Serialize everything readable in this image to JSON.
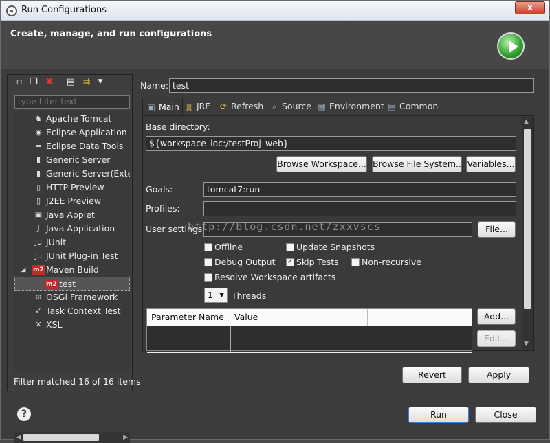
{
  "window": {
    "title": "Run Configurations",
    "close_label": "x"
  },
  "header": {
    "title": "Create, manage, and run configurations",
    "run_icon": "run-icon"
  },
  "left": {
    "toolbar_icons": [
      "new-configuration-icon",
      "duplicate-icon",
      "delete-icon",
      "collapse-all-icon",
      "filter-icon",
      "dropdown-icon"
    ],
    "filter_placeholder": "type filter text",
    "tree": [
      {
        "label": "Apache Tomcat",
        "icon": "tomcat-icon",
        "level": 0
      },
      {
        "label": "Eclipse Application",
        "icon": "eclipse-icon",
        "level": 0
      },
      {
        "label": "Eclipse Data Tools",
        "icon": "data-tools-icon",
        "level": 0
      },
      {
        "label": "Generic Server",
        "icon": "server-icon",
        "level": 0
      },
      {
        "label": "Generic Server(Extern",
        "icon": "server-icon",
        "level": 0
      },
      {
        "label": "HTTP Preview",
        "icon": "http-icon",
        "level": 0
      },
      {
        "label": "J2EE Preview",
        "icon": "j2ee-icon",
        "level": 0
      },
      {
        "label": "Java Applet",
        "icon": "applet-icon",
        "level": 0
      },
      {
        "label": "Java Application",
        "icon": "java-app-icon",
        "level": 0
      },
      {
        "label": "JUnit",
        "icon": "junit-icon",
        "level": 0
      },
      {
        "label": "JUnit Plug-in Test",
        "icon": "junit-plugin-icon",
        "level": 0
      },
      {
        "label": "Maven Build",
        "icon": "maven-icon",
        "level": 0,
        "expanded": true
      },
      {
        "label": "test",
        "icon": "maven-icon",
        "level": 1,
        "selected": true
      },
      {
        "label": "OSGi Framework",
        "icon": "osgi-icon",
        "level": 0
      },
      {
        "label": "Task Context Test",
        "icon": "task-icon",
        "level": 0
      },
      {
        "label": "XSL",
        "icon": "xsl-icon",
        "level": 0
      }
    ],
    "filter_message": "Filter matched 16 of 16 items"
  },
  "config": {
    "name_label": "Name:",
    "name_value": "test",
    "tabs": [
      {
        "label": "Main",
        "icon": "main-tab-icon",
        "active": true
      },
      {
        "label": "JRE",
        "icon": "jre-tab-icon"
      },
      {
        "label": "Refresh",
        "icon": "refresh-tab-icon"
      },
      {
        "label": "Source",
        "icon": "source-tab-icon"
      },
      {
        "label": "Environment",
        "icon": "environment-tab-icon"
      },
      {
        "label": "Common",
        "icon": "common-tab-icon"
      }
    ],
    "base_dir_label": "Base directory:",
    "base_dir_value": "${workspace_loc:/testProj_web}",
    "browse_workspace": "Browse Workspace...",
    "browse_fs": "Browse File System...",
    "variables": "Variables...",
    "goals_label": "Goals:",
    "goals_value": "tomcat7:run",
    "profiles_label": "Profiles:",
    "profiles_value": "",
    "user_settings_label": "User settings:",
    "user_settings_value": "",
    "file_button": "File...",
    "checkboxes": {
      "offline": {
        "label": "Offline",
        "checked": false
      },
      "update_snapshots": {
        "label": "Update Snapshots",
        "checked": false
      },
      "debug_output": {
        "label": "Debug Output",
        "checked": false
      },
      "skip_tests": {
        "label": "Skip Tests",
        "checked": true
      },
      "non_recursive": {
        "label": "Non-recursive",
        "checked": false
      },
      "resolve_workspace": {
        "label": "Resolve Workspace artifacts",
        "checked": false
      }
    },
    "threads_value": "1",
    "threads_label": "Threads",
    "table": {
      "columns": [
        "Parameter Name",
        "Value"
      ]
    },
    "add_button": "Add...",
    "edit_button": "Edit...",
    "watermark": "http://blog.csdn.net/zxxvscs"
  },
  "footer": {
    "revert": "Revert",
    "apply": "Apply",
    "run": "Run",
    "close": "Close",
    "help": "?"
  }
}
